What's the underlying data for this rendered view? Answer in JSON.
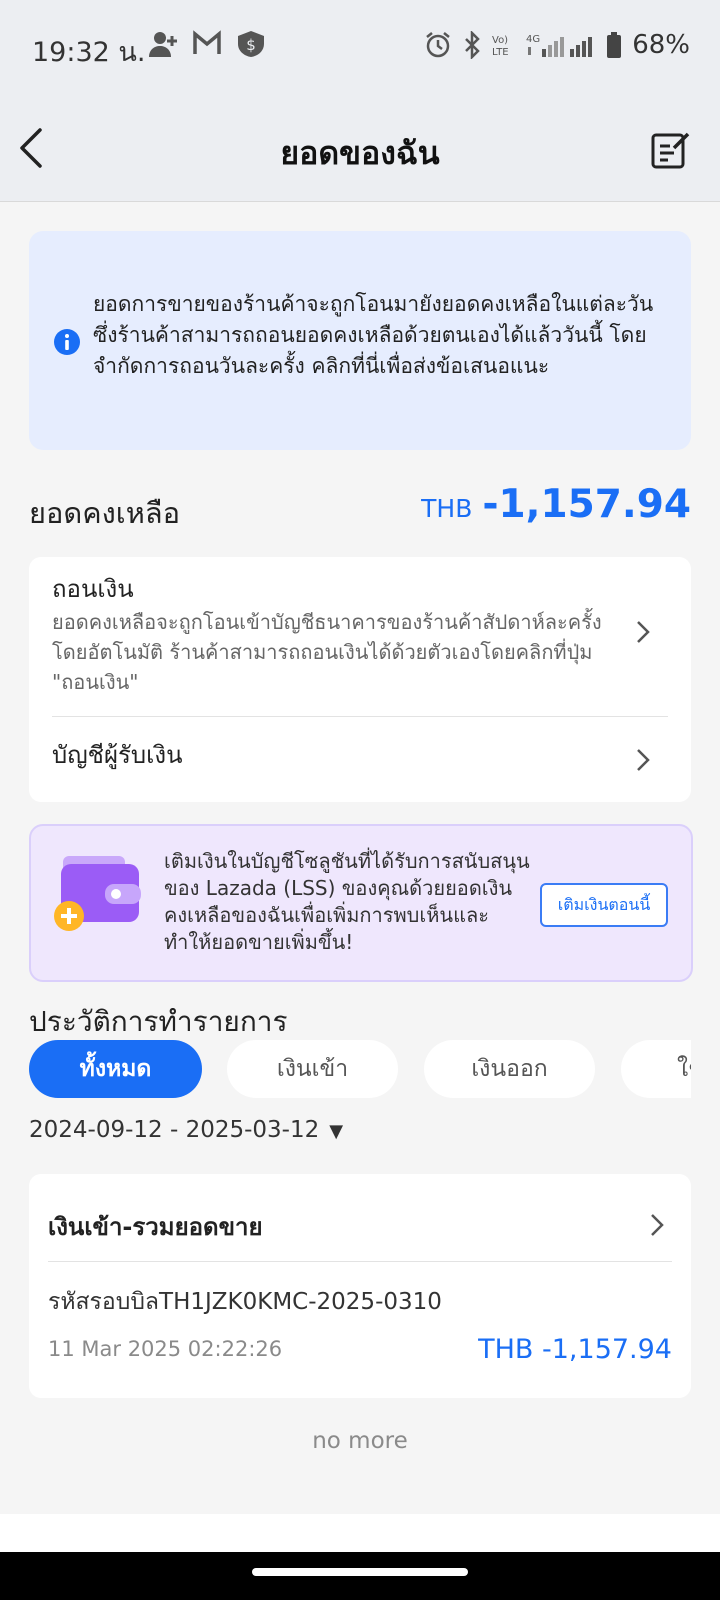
{
  "status_bar": {
    "time": "19:32 น.",
    "battery": "68%"
  },
  "header": {
    "title": "ยอดของฉัน"
  },
  "info_banner": {
    "text": "ยอดการขายของร้านค้าจะถูกโอนมายังยอดคงเหลือในแต่ละวัน ซึ่งร้านค้าสามารถถอนยอดคงเหลือด้วยตนเองได้แล้ววันนี้ โดยจำกัดการถอนวันละครั้ง คลิกที่นี่เพื่อส่งข้อเสนอแนะ"
  },
  "balance": {
    "label": "ยอดคงเหลือ",
    "currency": "THB",
    "amount": "-1,157.94"
  },
  "withdraw": {
    "title": "ถอนเงิน",
    "description": "ยอดคงเหลือจะถูกโอนเข้าบัญชีธนาคารของร้านค้าสัปดาห์ละครั้งโดยอัตโนมัติ ร้านค้าสามารถถอนเงินได้ด้วยตัวเองโดยคลิกที่ปุ่ม \"ถอนเงิน\"",
    "payee_label": "บัญชีผู้รับเงิน"
  },
  "promo": {
    "text": "เติมเงินในบัญชีโซลูชันที่ได้รับการสนับสนุนของ Lazada (LSS) ของคุณด้วยยอดเงินคงเหลือของฉันเพื่อเพิ่มการพบเห็นและทำให้ยอดขายเพิ่มขึ้น!",
    "button": "เติมเงินตอนนี้"
  },
  "history": {
    "title": "ประวัติการทำรายการ",
    "tabs": [
      "ทั้งหมด",
      "เงินเข้า",
      "เงินออก",
      "ใช้"
    ],
    "active_tab": "ทั้งหมด",
    "date_range": "2024-09-12 - 2025-03-12"
  },
  "transaction": {
    "heading": "เงินเข้า-รวมยอดขาย",
    "reference": "รหัสรอบบิลTH1JZK0KMC-2025-0310",
    "datetime": "11 Mar 2025 02:22:26",
    "amount": "THB -1,157.94"
  },
  "footer": {
    "no_more": "no more"
  },
  "colors": {
    "accent": "#1a6ef5",
    "info_bg": "#e6edfe",
    "promo_bg": "#efe7fd"
  }
}
